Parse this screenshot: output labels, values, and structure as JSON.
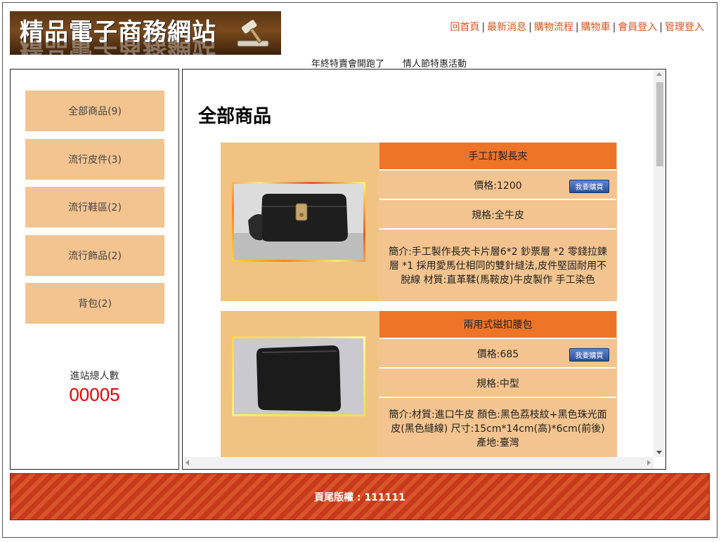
{
  "header": {
    "logo_text": "精品電子商務網站",
    "nav": [
      {
        "label": "回首頁"
      },
      {
        "label": "最新消息"
      },
      {
        "label": "購物流程"
      },
      {
        "label": "購物車"
      },
      {
        "label": "會員登入"
      },
      {
        "label": "管理登入"
      }
    ],
    "marquee": "年終特賣會開跑了　　情人節特惠活動"
  },
  "sidebar": {
    "categories": [
      {
        "label": "全部商品(9)"
      },
      {
        "label": "流行皮件(3)"
      },
      {
        "label": "流行鞋區(2)"
      },
      {
        "label": "流行飾品(2)"
      },
      {
        "label": "背包(2)"
      }
    ],
    "counter_label": "進站總人數",
    "counter_value": "00005"
  },
  "main": {
    "title": "全部商品",
    "products": [
      {
        "name": "手工訂製長夾",
        "price": "價格:1200",
        "spec": "規格:全牛皮",
        "desc": "簡介:手工製作長夾卡片層6*2 鈔票層 *2 零錢拉鍊層 *1 採用愛馬仕相同的雙針縫法,皮件堅固耐用不脫線 材質:直革鞣(馬鞍皮)牛皮製作 手工染色",
        "buy_label": "我要購買"
      },
      {
        "name": "兩用式磁扣腰包",
        "price": "價格:685",
        "spec": "規格:中型",
        "desc": "簡介:材質:進口牛皮 顏色:黑色荔枝紋+黑色珠光面皮(黑色縫線) 尺寸:15cm*14cm(高)*6cm(前後) 產地:臺灣",
        "buy_label": "我要購買"
      }
    ]
  },
  "footer": {
    "copyright": "頁尾版權 : 111111"
  },
  "colors": {
    "accent": "#ee7428",
    "category_bg": "#f3c48f",
    "counter": "#e60000",
    "nav_link": "#d9541e"
  }
}
